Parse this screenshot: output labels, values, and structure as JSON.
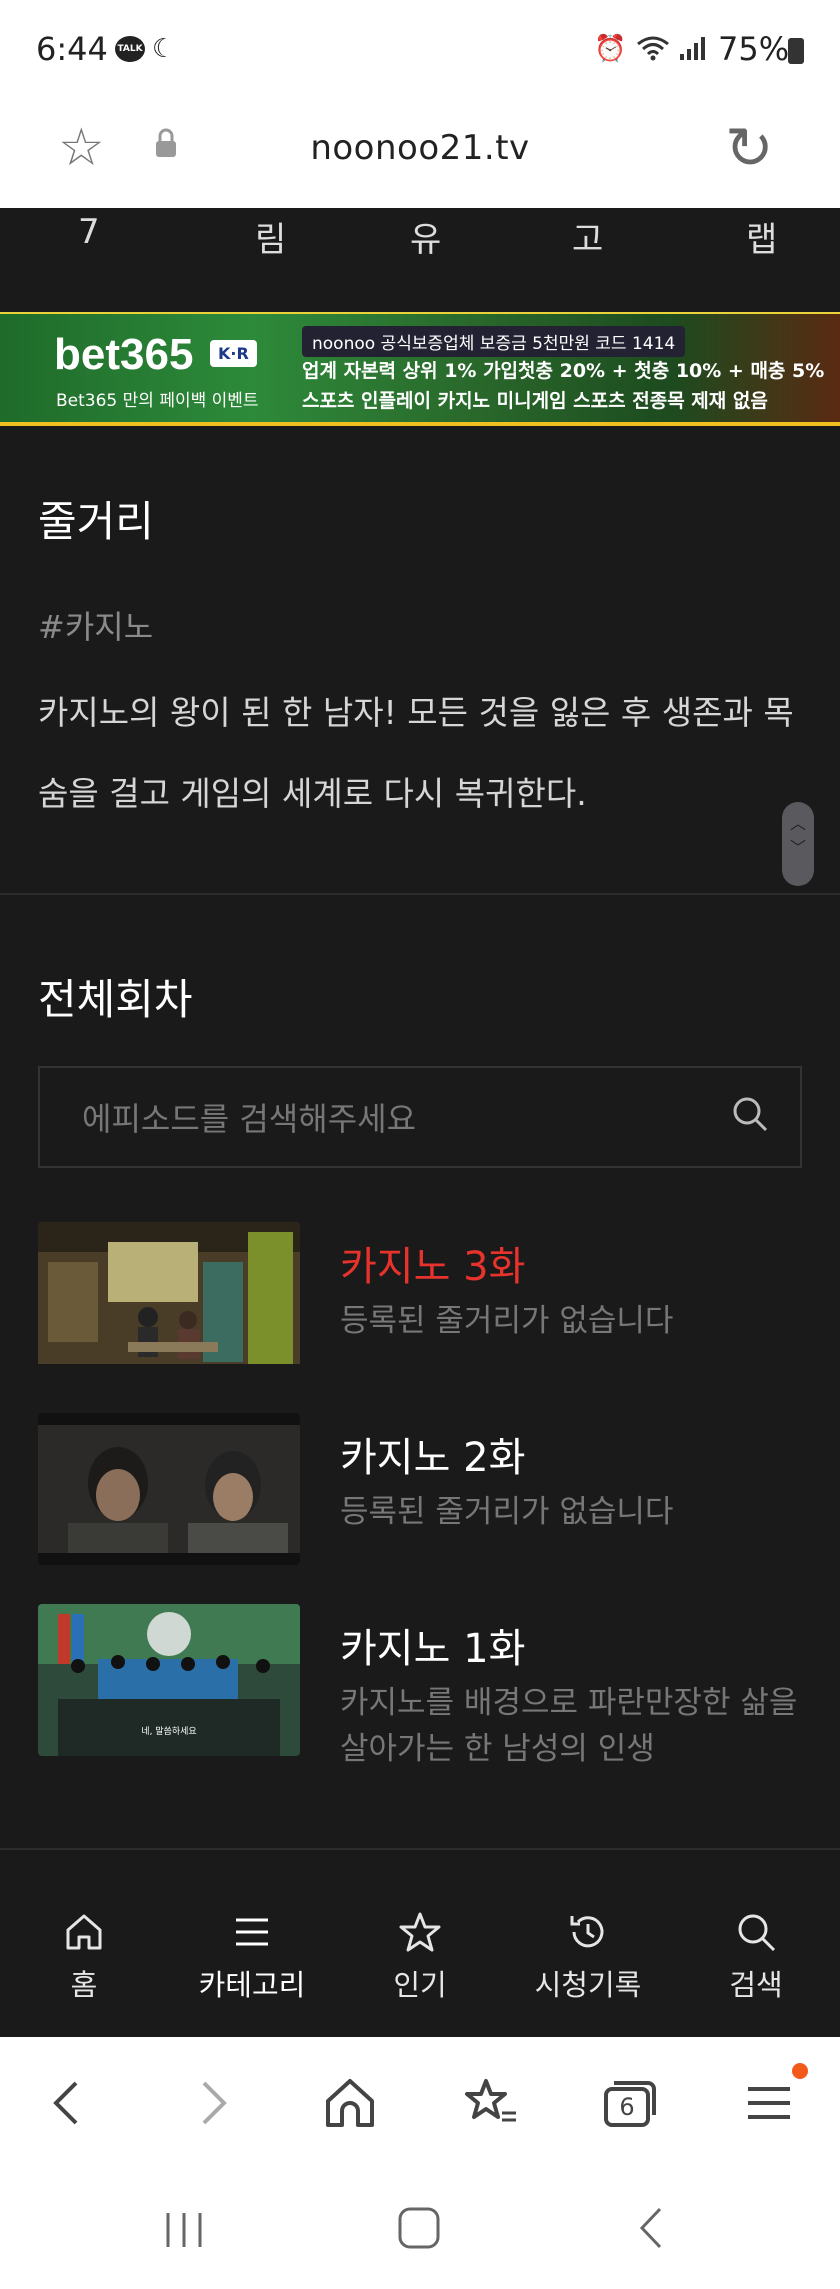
{
  "status": {
    "time": "6:44",
    "talk_badge": "TALK",
    "battery": "75%"
  },
  "browser": {
    "url": "noonoo21.tv",
    "tab_count": "6"
  },
  "top_letters": [
    "7",
    "림",
    "유",
    "고",
    "랩"
  ],
  "banner": {
    "logo_text": "bet365",
    "logo_badge": "K·R",
    "subtitle": "Bet365 만의 페이백 이벤트",
    "row1": "noonoo 공식보증업체  보증금 5천만원  코드 1414",
    "row2": "업계 자본력 상위 1%  가입첫충 20% + 첫충 10% + 매충 5%",
    "row3": "스포츠 인플레이  카지노 미니게임  스포츠 전종목  제재 없음"
  },
  "synopsis": {
    "title": "줄거리",
    "tag": "#카지노",
    "text": "카지노의 왕이 된 한 남자! 모든 것을 잃은 후 생존과 목숨을 걸고 게임의 세계로 다시 복귀한다."
  },
  "episodes": {
    "title": "전체회차",
    "search_placeholder": "에피소드를 검색해주세요",
    "items": [
      {
        "title": "카지노 3화",
        "desc": "등록된 줄거리가 없습니다"
      },
      {
        "title": "카지노 2화",
        "desc": "등록된 줄거리가 없습니다"
      },
      {
        "title": "카지노 1화",
        "desc": "카지노를 배경으로 파란만장한 삶을 살아가는 한 남성의 인생",
        "subtitle_in_thumb": "네, 말씀하세요"
      }
    ]
  },
  "site_nav": [
    {
      "label": "홈",
      "icon": "home-icon"
    },
    {
      "label": "카테고리",
      "icon": "menu-icon"
    },
    {
      "label": "인기",
      "icon": "star-icon"
    },
    {
      "label": "시청기록",
      "icon": "history-icon"
    },
    {
      "label": "검색",
      "icon": "search-icon"
    }
  ],
  "colors": {
    "accent_red": "#e8332c",
    "background": "#1a1a1b"
  }
}
